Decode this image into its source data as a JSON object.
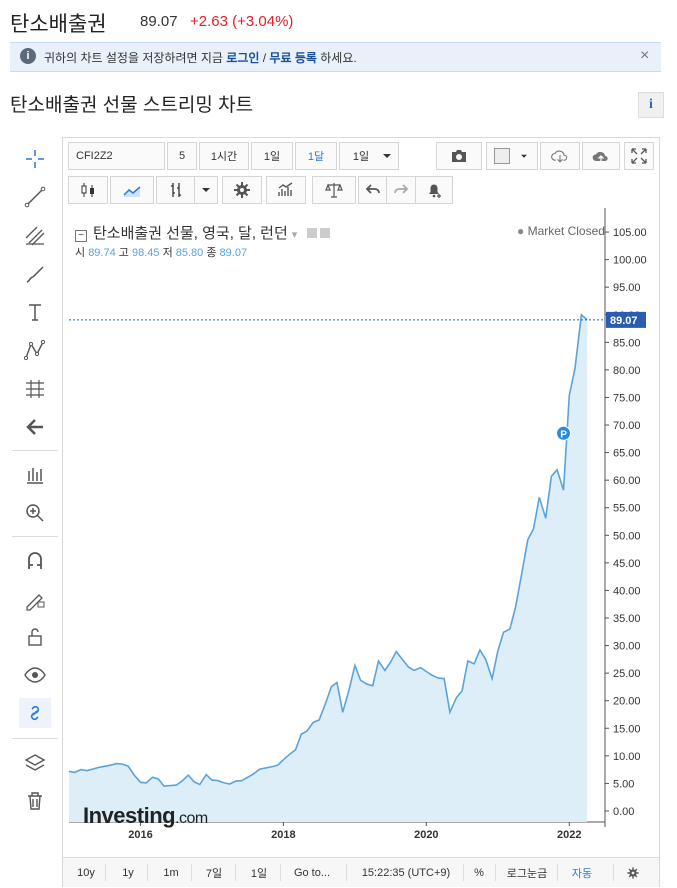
{
  "header": {
    "title": "탄소배출권",
    "price": "89.07",
    "change": "+2.63 (+3.04%)"
  },
  "info_bar": {
    "icon": "i",
    "text_before": "귀하의 차트 설정을 저장하려면 지금 ",
    "login": "로그인",
    "slash": " / ",
    "register": "무료 등록",
    "text_after": " 하세요.",
    "close": "×"
  },
  "section": {
    "title": "탄소배출권 선물 스트리밍 차트",
    "info_icon": "i"
  },
  "left_tools": [
    "crosshair-icon",
    "trendline-icon",
    "fib-tools-icon",
    "brush-icon",
    "text-tool-icon",
    "pattern-icon",
    "measure-icon",
    "back-arrow-icon",
    "long-position-icon",
    "zoom-in-icon",
    "magnet-icon",
    "lock-drawings-icon",
    "unlock-icon",
    "eye-icon",
    "link-icon",
    "layers-icon",
    "trash-icon"
  ],
  "toolbar": {
    "symbol": "CFI2Z2",
    "qty": "5",
    "intervals": [
      "1시간",
      "1일",
      "1달",
      "1일"
    ],
    "active_interval": "1달"
  },
  "legend": {
    "name": "탄소배출권 선물, 영국, 달, 런던",
    "open_label": "시",
    "open": "89.74",
    "high_label": "고",
    "high": "98.45",
    "low_label": "저",
    "low": "85.80",
    "close_label": "종",
    "close": "89.07",
    "market_status": "Market Closed"
  },
  "watermark": {
    "brand": "Investing",
    "suffix": ".com"
  },
  "bottom_bar": {
    "ranges": [
      "10y",
      "1y",
      "1m",
      "7일",
      "1일",
      "Go to..."
    ],
    "time": "15:22:35 (UTC+9)",
    "percent": "%",
    "log": "로그눈금",
    "auto": "자동"
  },
  "chart_data": {
    "type": "area",
    "last_value_label": "89.07",
    "marker_label": "P",
    "x_ticks": [
      "2016",
      "2018",
      "2020",
      "2022"
    ],
    "y_ticks": [
      "0.00",
      "5.00",
      "10.00",
      "15.00",
      "20.00",
      "25.00",
      "30.00",
      "35.00",
      "40.00",
      "45.00",
      "50.00",
      "55.00",
      "60.00",
      "65.00",
      "70.00",
      "75.00",
      "80.00",
      "85.00",
      "90.00",
      "95.00",
      "100.00",
      "105.00"
    ],
    "ylim": [
      -2,
      109
    ],
    "xlim": [
      2015.0,
      2022.5
    ],
    "color": "#5ba3dc",
    "fill": "#ddeef9",
    "series": [
      {
        "values": [
          [
            2015.0,
            7.2
          ],
          [
            2015.08,
            7.0
          ],
          [
            2015.17,
            7.5
          ],
          [
            2015.25,
            7.3
          ],
          [
            2015.33,
            7.6
          ],
          [
            2015.42,
            7.9
          ],
          [
            2015.5,
            8.1
          ],
          [
            2015.58,
            8.3
          ],
          [
            2015.67,
            8.6
          ],
          [
            2015.75,
            8.5
          ],
          [
            2015.83,
            8.1
          ],
          [
            2015.92,
            6.4
          ],
          [
            2016.0,
            5.2
          ],
          [
            2016.08,
            5.1
          ],
          [
            2016.17,
            6.1
          ],
          [
            2016.25,
            5.8
          ],
          [
            2016.33,
            4.5
          ],
          [
            2016.42,
            4.6
          ],
          [
            2016.5,
            4.7
          ],
          [
            2016.58,
            5.4
          ],
          [
            2016.67,
            6.5
          ],
          [
            2016.75,
            5.3
          ],
          [
            2016.83,
            4.8
          ],
          [
            2016.92,
            6.6
          ],
          [
            2017.0,
            5.6
          ],
          [
            2017.08,
            5.5
          ],
          [
            2017.17,
            5.1
          ],
          [
            2017.25,
            4.9
          ],
          [
            2017.33,
            5.4
          ],
          [
            2017.42,
            5.5
          ],
          [
            2017.5,
            6.1
          ],
          [
            2017.58,
            6.7
          ],
          [
            2017.67,
            7.6
          ],
          [
            2017.75,
            7.8
          ],
          [
            2017.83,
            8.0
          ],
          [
            2017.92,
            8.3
          ],
          [
            2018.0,
            9.3
          ],
          [
            2018.08,
            10.2
          ],
          [
            2018.17,
            11.1
          ],
          [
            2018.25,
            13.9
          ],
          [
            2018.33,
            14.5
          ],
          [
            2018.42,
            16.1
          ],
          [
            2018.5,
            16.5
          ],
          [
            2018.58,
            19.2
          ],
          [
            2018.67,
            22.5
          ],
          [
            2018.75,
            23.3
          ],
          [
            2018.83,
            17.9
          ],
          [
            2018.92,
            22.0
          ],
          [
            2019.0,
            26.4
          ],
          [
            2019.08,
            23.7
          ],
          [
            2019.17,
            23.0
          ],
          [
            2019.25,
            22.7
          ],
          [
            2019.33,
            27.2
          ],
          [
            2019.42,
            25.5
          ],
          [
            2019.5,
            27.0
          ],
          [
            2019.58,
            28.9
          ],
          [
            2019.67,
            27.4
          ],
          [
            2019.75,
            26.1
          ],
          [
            2019.83,
            25.5
          ],
          [
            2019.92,
            26.0
          ],
          [
            2020.0,
            25.3
          ],
          [
            2020.08,
            24.6
          ],
          [
            2020.17,
            24.1
          ],
          [
            2020.25,
            24.0
          ],
          [
            2020.33,
            17.9
          ],
          [
            2020.42,
            20.5
          ],
          [
            2020.5,
            21.8
          ],
          [
            2020.58,
            27.2
          ],
          [
            2020.67,
            26.7
          ],
          [
            2020.75,
            29.2
          ],
          [
            2020.83,
            27.5
          ],
          [
            2020.92,
            24.0
          ],
          [
            2021.0,
            29.0
          ],
          [
            2021.08,
            32.4
          ],
          [
            2021.17,
            33.0
          ],
          [
            2021.25,
            37.1
          ],
          [
            2021.33,
            42.7
          ],
          [
            2021.42,
            49.2
          ],
          [
            2021.5,
            51.2
          ],
          [
            2021.58,
            56.9
          ],
          [
            2021.67,
            53.1
          ],
          [
            2021.75,
            60.7
          ],
          [
            2021.83,
            61.9
          ],
          [
            2021.92,
            58.2
          ],
          [
            2022.0,
            75.4
          ],
          [
            2022.08,
            80.3
          ],
          [
            2022.17,
            90.0
          ],
          [
            2022.25,
            89.07
          ]
        ]
      }
    ],
    "marker_at": [
      2021.92,
      68.5
    ]
  }
}
